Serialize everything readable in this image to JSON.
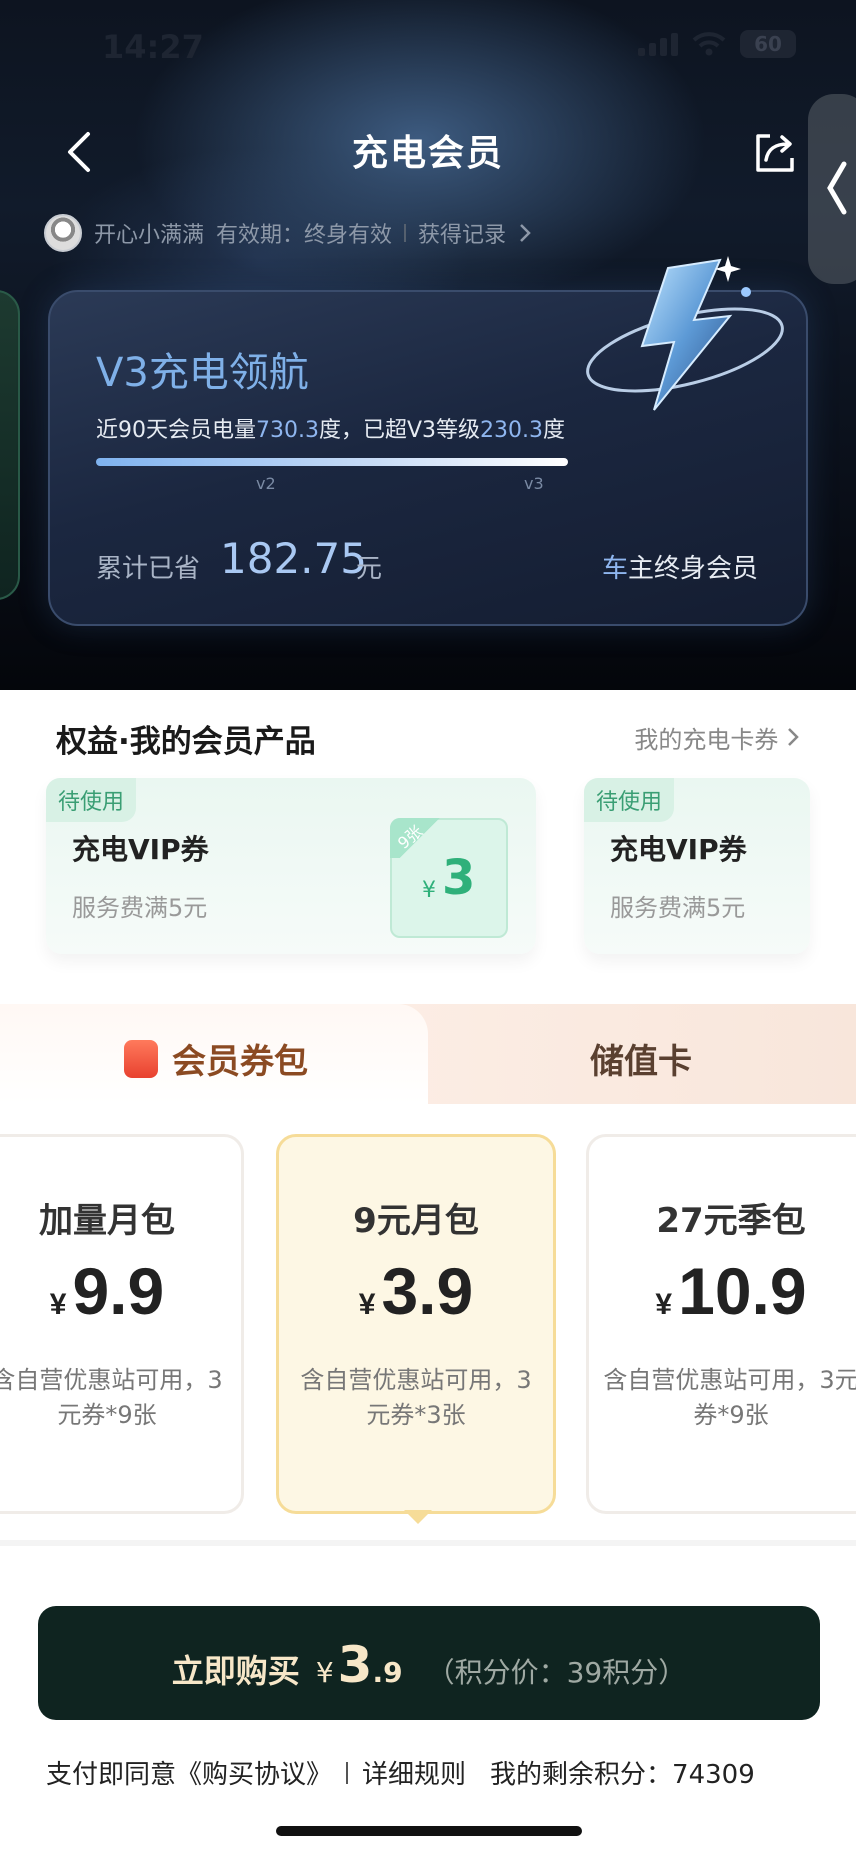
{
  "status_bar": {
    "time": "14:27",
    "battery": "60"
  },
  "header": {
    "title": "充电会员"
  },
  "user": {
    "name": "开心小满满",
    "validity": "有效期：终身有效",
    "record_link": "获得记录"
  },
  "level_card": {
    "title": "V3充电领航",
    "desc_prefix": "近90天会员电量",
    "usage": "730.3",
    "desc_mid": "度，已超V3等级",
    "exceed": "230.3",
    "desc_suffix": "度",
    "progress": 1.0,
    "marker_v2": "v2",
    "marker_v3": "v3",
    "saved_label": "累计已省",
    "saved_value": "182.75",
    "saved_unit": "元",
    "membership_prefix": "车",
    "membership_rest": "主终身会员"
  },
  "benefits": {
    "title": "权益·我的会员产品",
    "link": "我的充电卡券",
    "coupons": [
      {
        "tag": "待使用",
        "name": "充电VIP券",
        "desc": "服务费满5元",
        "currency": "¥",
        "value": "3",
        "count": "9张"
      },
      {
        "tag": "待使用",
        "name": "充电VIP券",
        "desc": "服务费满5元"
      }
    ]
  },
  "tabs": [
    {
      "label": "会员券包",
      "active": true
    },
    {
      "label": "储值卡",
      "active": false
    }
  ],
  "packages": [
    {
      "name": "加量月包",
      "currency": "¥",
      "price": "9.9",
      "desc": "含自营优惠站可用，3元券*9张",
      "selected": false
    },
    {
      "name": "9元月包",
      "currency": "¥",
      "price": "3.9",
      "desc": "含自营优惠站可用，3元券*3张",
      "selected": true
    },
    {
      "name": "27元季包",
      "currency": "¥",
      "price": "10.9",
      "desc": "含自营优惠站可用，3元券*9张",
      "selected": false
    }
  ],
  "buy": {
    "label": "立即购买",
    "currency": "¥",
    "price_int": "3",
    "price_dec": ".9",
    "points_text": "（积分价：39积分）"
  },
  "footer": {
    "agreement": "支付即同意《购买协议》",
    "rules": "详细规则",
    "points": "我的剩余积分：74309"
  },
  "colors": {
    "accent_blue": "#8fb6ef",
    "coupon_green": "#2fb07a",
    "buy_bg": "#0f2420",
    "tab_brown": "#8b4a22"
  }
}
